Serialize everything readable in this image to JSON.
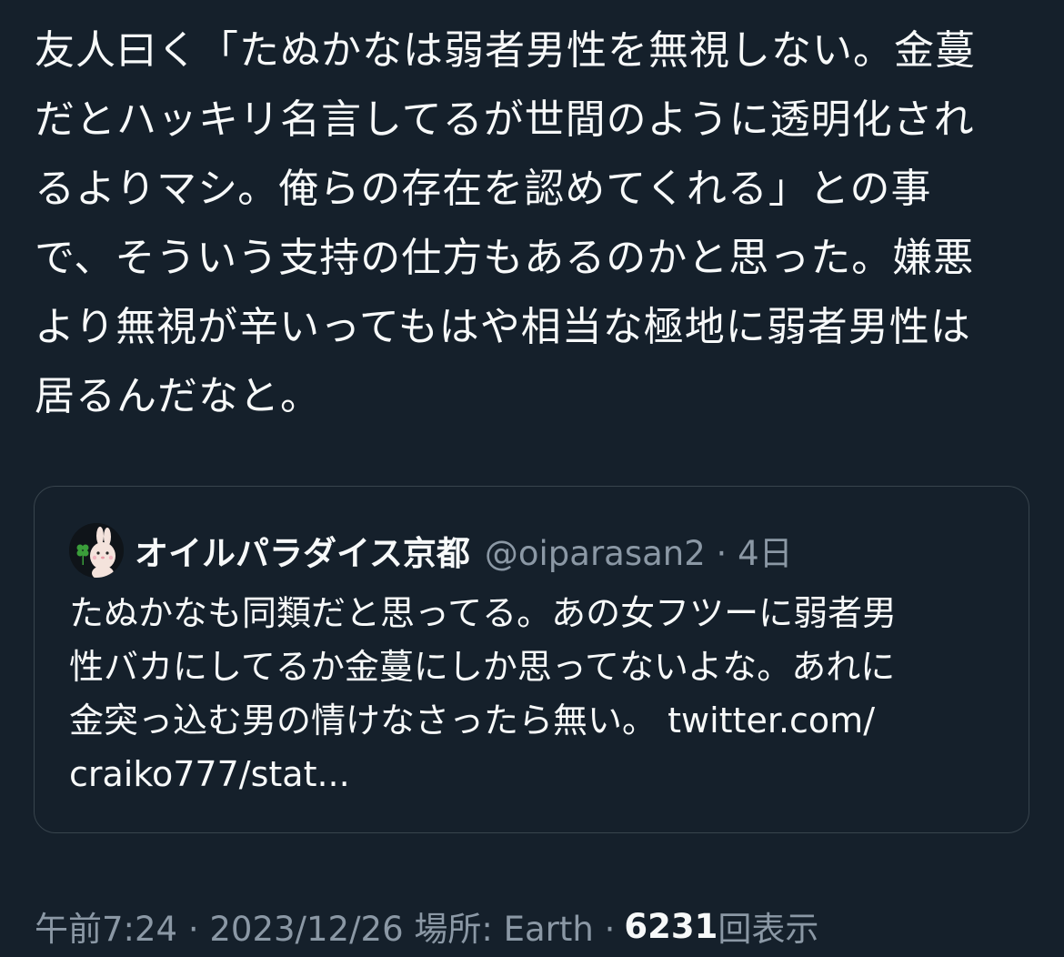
{
  "tweet": {
    "lines": [
      "友人曰く「たぬかなは弱者男性を無視しない。金蔓",
      "だとハッキリ名言してるが世間のように透明化され",
      "るよりマシ。俺らの存在を認めてくれる」との事",
      "で、そういう支持の仕方もあるのかと思った。嫌悪",
      "より無視が辛いってもはや相当な極地に弱者男性は",
      "居るんだなと。"
    ]
  },
  "quote": {
    "author_name": "オイルパラダイス京都",
    "handle_time": "@oiparasan2 · 4日",
    "lines": [
      "たぬかなも同類だと思ってる。あの女フツーに弱者男",
      "性バカにしてるか金蔓にしか思ってないよな。あれに"
    ],
    "line3_text": "金突っ込む男の情けなさったら無い。",
    "link_part1": "twitter.com/",
    "link_part2": "craiko777/stat...",
    "avatar_icon": "bunny-clover-avatar"
  },
  "meta": {
    "time_date_place": "午前7:24 · 2023/12/26 場所: Earth ·",
    "views_count": "6231",
    "views_label": "回表示"
  },
  "colors": {
    "background": "#15202b",
    "text": "#f7f9f9",
    "secondary": "#8b98a5",
    "border": "#38444d"
  }
}
